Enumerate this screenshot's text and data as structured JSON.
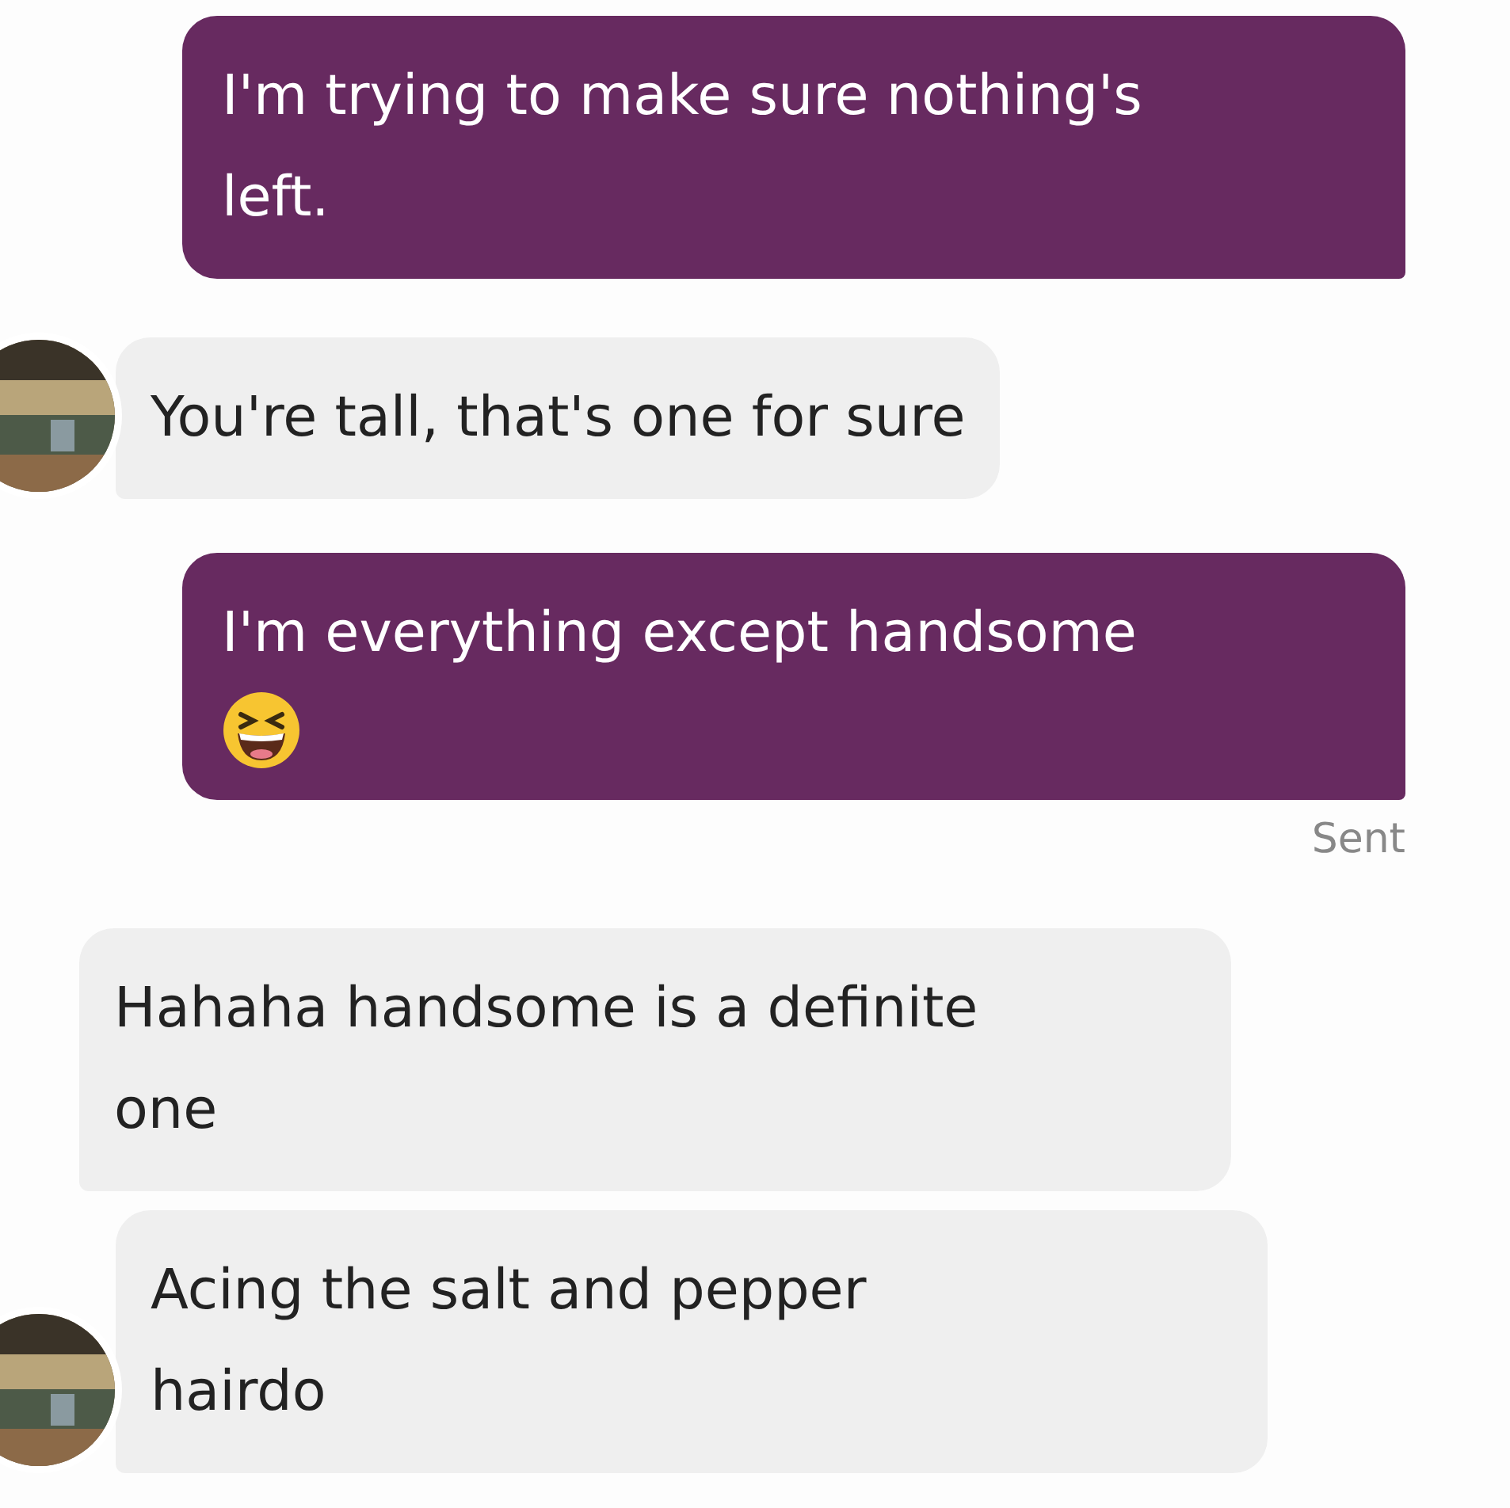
{
  "messages": [
    {
      "kind": "sent",
      "lines": [
        "I'm trying to make sure nothing's",
        "left."
      ],
      "emoji": false
    },
    {
      "kind": "received",
      "lines": [
        "You're tall, that's one for sure"
      ],
      "avatar": true
    },
    {
      "kind": "sent",
      "lines": [
        "I'm everything except handsome"
      ],
      "emoji": true
    },
    {
      "kind": "status",
      "lines": [
        "Sent"
      ]
    },
    {
      "kind": "received",
      "lines": [
        "Hahaha handsome is a definite",
        "one"
      ],
      "avatar": false
    },
    {
      "kind": "received",
      "lines": [
        "Acing the salt and pepper",
        "hairdo"
      ],
      "avatar": true
    }
  ]
}
